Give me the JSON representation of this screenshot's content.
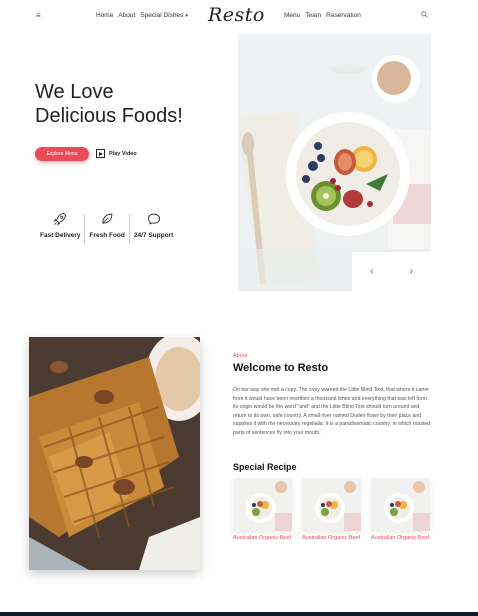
{
  "nav": {
    "left_links": [
      "Home",
      "About",
      "Special Dishes"
    ],
    "right_links": [
      "Menu",
      "Team",
      "Reservation"
    ],
    "logo": "Resto",
    "dropdown_caret": "▾",
    "menu_icon": "≡"
  },
  "hero": {
    "title_line1": "We Love",
    "title_line2": "Delicious Foods!",
    "explore_button": "Explore Menu",
    "play_video": "Play Video"
  },
  "features": [
    {
      "icon": "rocket-icon",
      "label": "Fast Delivery"
    },
    {
      "icon": "leaf-icon",
      "label": "Fresh Food"
    },
    {
      "icon": "chat-icon",
      "label": "24/7 Support"
    }
  ],
  "slider": {
    "prev": "‹",
    "next": "›"
  },
  "about": {
    "small_label": "About",
    "title": "Welcome to Resto",
    "body": "On her way she met a copy. The copy warned the Little Blind Text, that where it came from it would have been rewritten a thousand times and everything that was left from its origin would be the word \"and\" and the Little Blind Text should turn around and return to its own, safe country. A small river named Duden flows by their place and supplies it with the necessary regelialia. It is a paradisematic country, in which roasted parts of sentences fly into your mouth."
  },
  "special": {
    "title": "Special Recipe",
    "items": [
      {
        "name": "Australian Organic Beef"
      },
      {
        "name": "Australian Organic Beef"
      },
      {
        "name": "Australian Organic Beef"
      }
    ]
  },
  "colors": {
    "accent": "#e84c5a",
    "footer": "#0f1b2a"
  }
}
